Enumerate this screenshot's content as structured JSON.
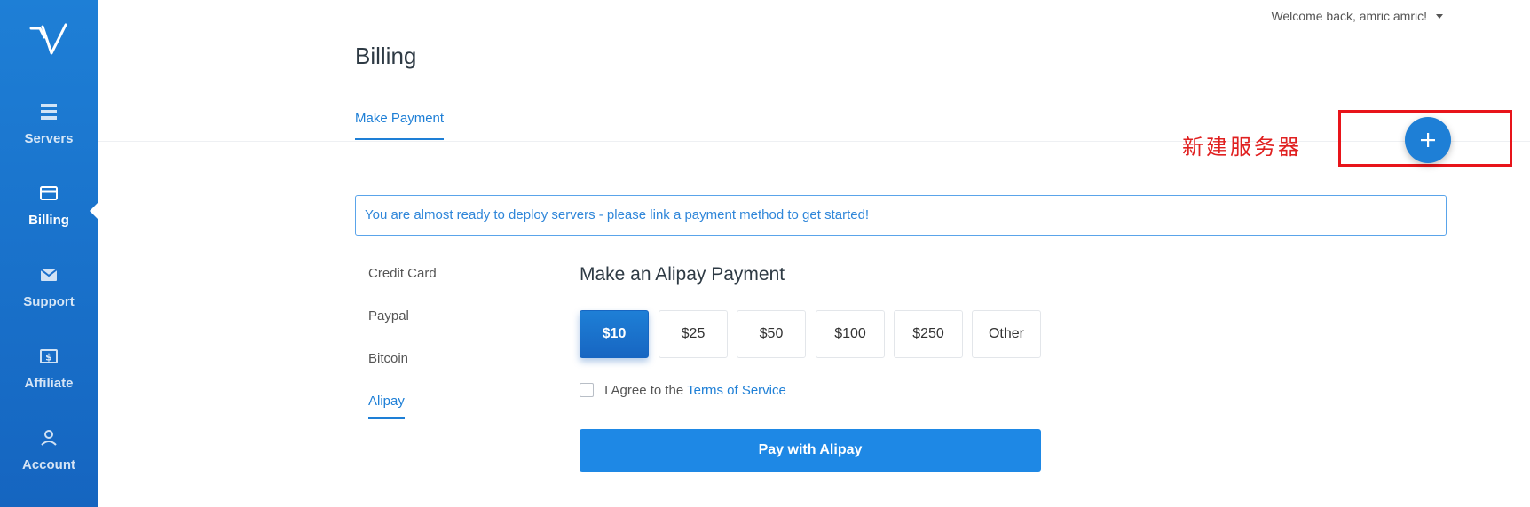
{
  "header": {
    "welcome": "Welcome back, amric amric!"
  },
  "sidebar": {
    "items": [
      {
        "label": "Servers",
        "icon": "servers-icon"
      },
      {
        "label": "Billing",
        "icon": "billing-card-icon",
        "active": true
      },
      {
        "label": "Support",
        "icon": "mail-icon"
      },
      {
        "label": "Affiliate",
        "icon": "dollar-icon"
      },
      {
        "label": "Account",
        "icon": "user-icon"
      }
    ]
  },
  "page": {
    "title": "Billing"
  },
  "tabs": [
    {
      "label": "Make Payment",
      "active": true
    }
  ],
  "annotation": {
    "text": "新建服务器",
    "color": "#e8141a"
  },
  "fab": {
    "icon": "plus-icon"
  },
  "alert": {
    "text": "You are almost ready to deploy servers - please link a payment method to get started!"
  },
  "payment_methods": [
    {
      "label": "Credit Card"
    },
    {
      "label": "Paypal"
    },
    {
      "label": "Bitcoin"
    },
    {
      "label": "Alipay",
      "active": true
    }
  ],
  "alipay": {
    "title": "Make an Alipay Payment",
    "amounts": [
      "$10",
      "$25",
      "$50",
      "$100",
      "$250",
      "Other"
    ],
    "selected_amount": "$10",
    "agree_prefix": "I Agree to the",
    "terms_link": "Terms of Service",
    "agreed": false,
    "pay_button": "Pay with Alipay"
  },
  "colors": {
    "accent": "#1e7fd6",
    "sidebar": "#1565c0",
    "annotation": "#e8141a"
  }
}
